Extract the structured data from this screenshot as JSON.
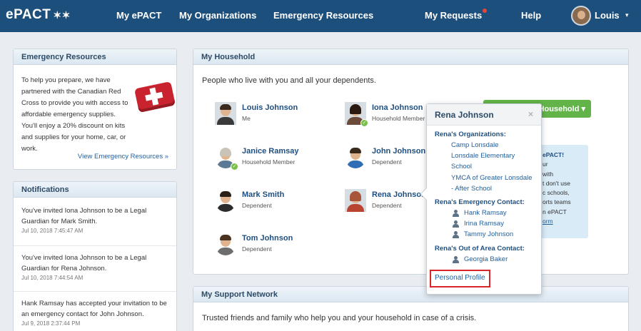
{
  "colors": {
    "nav_bg": "#1d4f7c",
    "accent_green": "#62b448",
    "notification_dot": "#e8443a",
    "highlight_border": "#d9262b",
    "link": "#1f5f9e"
  },
  "nav": {
    "logo": "ePACT",
    "logo_icon": "stars-icon",
    "items": [
      "My ePACT",
      "My Organizations",
      "Emergency Resources",
      "My Requests",
      "Help"
    ],
    "user_name": "Louis",
    "caret": "▾"
  },
  "emergency_resources": {
    "title": "Emergency Resources",
    "text": "To help you prepare, we have partnered with the Canadian Red Cross to provide you with access to affordable emergency supplies. You'll enjoy a 20% discount on kits and supplies for your home, car, or work.",
    "image": "first-aid-kit",
    "link": "View Emergency Resources »"
  },
  "notifications": {
    "title": "Notifications",
    "items": [
      {
        "text": "You've invited Iona Johnson to be a Legal Guardian for Mark Smith.",
        "time": "Jul 10, 2018 7:45:47 AM"
      },
      {
        "text": "You've invited Iona Johnson to be a Legal Guardian for Rena Johnson.",
        "time": "Jul 10, 2018 7:44:54 AM"
      },
      {
        "text": "Hank Ramsay has accepted your invitation to be an emergency contact for John Johnson.",
        "time": "Jul 9, 2018 2:37:44 PM"
      }
    ]
  },
  "household": {
    "title": "My Household",
    "description": "People who live with you and all your dependents.",
    "members": [
      {
        "name": "Louis Johnson",
        "role": "Me"
      },
      {
        "name": "Iona Johnson",
        "role": "Household Member"
      },
      {
        "name": "Janice Ramsay",
        "role": "Household Member"
      },
      {
        "name": "John Johnson",
        "role": "Dependent"
      },
      {
        "name": "Mark Smith",
        "role": "Dependent"
      },
      {
        "name": "Rena Johnson",
        "role": "Dependent"
      },
      {
        "name": "Tom Johnson",
        "role": "Dependent"
      }
    ],
    "add_button": "Household ▾",
    "promo": {
      "title": "ePACT!",
      "lines": [
        "ur",
        "with",
        "t don't use",
        "c schools,",
        "orts teams",
        "n ePACT"
      ],
      "link": "orm"
    }
  },
  "popover": {
    "name": "Rena Johnson",
    "close": "×",
    "organizations_label": "Rena's Organizations:",
    "organizations": [
      "Camp Lonsdale",
      "Lonsdale Elementary",
      "School",
      "YMCA of Greater Lonsdale",
      "- After School"
    ],
    "emergency_label": "Rena's Emergency Contact:",
    "emergency_contacts": [
      "Hank Ramsay",
      "Irina Ramsay",
      "Tammy Johnson"
    ],
    "out_of_area_label": "Rena's Out of Area Contact:",
    "out_of_area_contacts": [
      "Georgia Baker"
    ],
    "profile_link": "Personal Profile"
  },
  "support_network": {
    "title": "My Support Network",
    "description": "Trusted friends and family who help you and your household in case of a crisis."
  }
}
